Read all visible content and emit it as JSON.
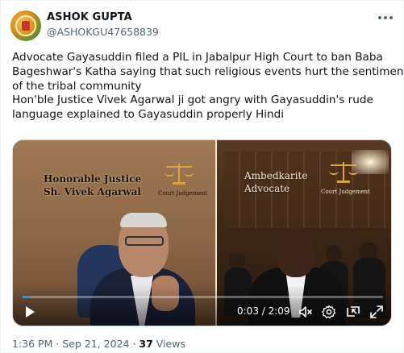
{
  "author": {
    "name": "ASHOK GUPTA",
    "handle": "@ASHOKGU47658839"
  },
  "tweet": {
    "lines": [
      "Advocate Gayasuddin filed a PIL in Jabalpur High Court to ban Baba",
      "Bageshwar's Katha saying that such religious events hurt the sentiments",
      "of the tribal community",
      "Hon'ble Justice Vivek Agarwal ji got angry with Gayasuddin's rude",
      "language explained to Gayasuddin properly Hindi"
    ]
  },
  "video": {
    "left_caption_line1": "Honorable Justice",
    "left_caption_line2": "Sh. Vivek Agarwal",
    "left_badge": "Court Judgement",
    "right_caption_line1": "Ambedkarite",
    "right_caption_line2": "Advocate",
    "right_badge": "Court Judgement",
    "time": "0:03 / 2:09",
    "progress": 0.023
  },
  "icons": {
    "play": "play-icon",
    "volume": "volume-muted-icon",
    "settings": "gear-icon",
    "pip": "picture-in-picture-icon",
    "fullscreen": "fullscreen-icon",
    "more": "more-icon"
  },
  "colors": {
    "accent": "#1d9bf0",
    "text_primary": "#0f1419",
    "text_secondary": "#536471"
  },
  "meta": {
    "timestamp": "1:36 PM · Sep 21, 2024 · ",
    "views_count": "37",
    "views_label": " Views"
  }
}
